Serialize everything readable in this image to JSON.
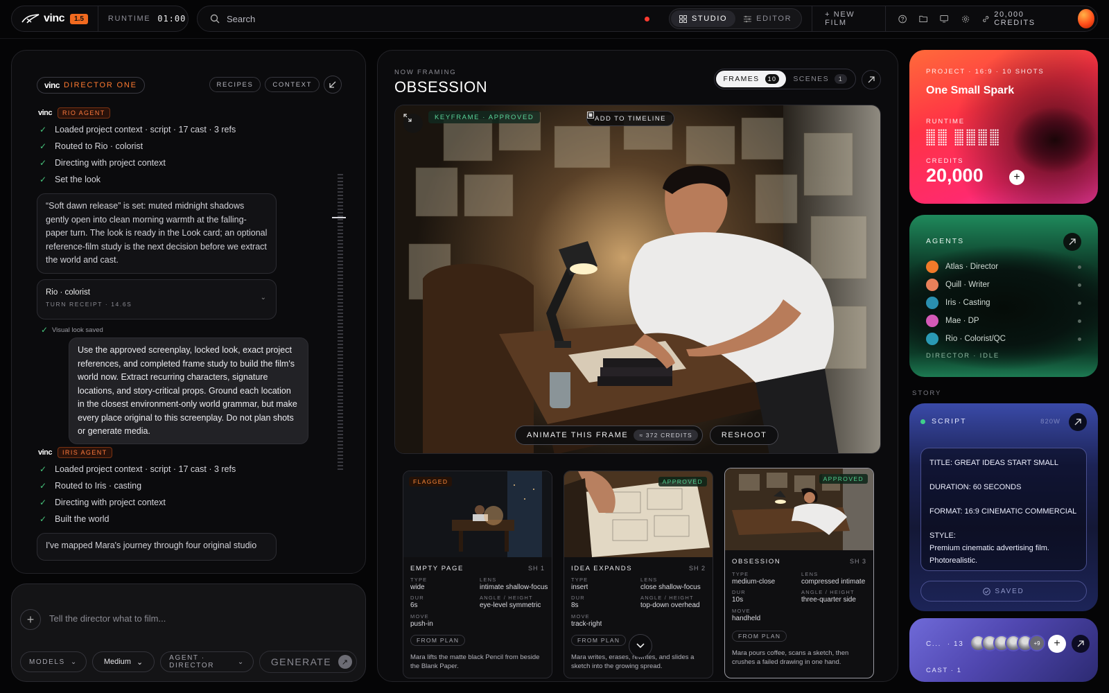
{
  "brand": {
    "name": "vinc",
    "version": "1.5",
    "runtime_label": "RUNTIME",
    "runtime_value": "01:00"
  },
  "search": {
    "placeholder": "Search"
  },
  "modes": [
    {
      "label": "STUDIO",
      "active": true
    },
    {
      "label": "EDITOR",
      "active": false
    }
  ],
  "topbar": {
    "new_film": "+ NEW FILM",
    "credits": "20,000 CREDITS"
  },
  "left": {
    "director_label": "DIRECTOR ONE",
    "buttons": {
      "recipes": "RECIPES",
      "context": "CONTEXT"
    },
    "agent1": {
      "tag": "RIO AGENT",
      "steps": [
        "Loaded project context · script · 17 cast · 3 refs",
        "Routed to Rio · colorist",
        "Directing with project context",
        "Set the look"
      ]
    },
    "message1": "“Soft dawn release” is set: muted midnight shadows gently open into clean morning warmth at the falling-paper turn. The look is ready in the Look card; an optional reference-film study is the next decision before we extract the world and cast.",
    "receipt": {
      "title": "Rio · colorist",
      "sub": "TURN RECEIPT · 14.6S"
    },
    "saved": "Visual look saved",
    "user_msg": "Use the approved screenplay, locked look, exact project references, and completed frame study to build the film's world now. Extract recurring characters, signature locations, and story-critical props. Ground each location in the closest environment-only world grammar, but make every place original to this screenplay. Do not plan shots or generate media.",
    "agent2": {
      "tag": "IRIS AGENT",
      "steps": [
        "Loaded project context · script · 17 cast · 3 refs",
        "Routed to Iris · casting",
        "Directing with project context",
        "Built the world"
      ]
    },
    "message2": "I've mapped Mara's journey through four original studio"
  },
  "composer": {
    "placeholder": "Tell the director what to film...",
    "models": "MODELS",
    "quality": "Medium",
    "agent": "AGENT · DIRECTOR",
    "generate": "GENERATE"
  },
  "center": {
    "now_label": "NOW FRAMING",
    "title": "OBSESSION",
    "frames_label": "FRAMES",
    "frames_count": "10",
    "scenes_label": "SCENES",
    "scenes_count": "1",
    "keyframe_tag": "KEYFRAME · APPROVED",
    "add_timeline": "ADD TO TIMELINE",
    "animate": "ANIMATE THIS FRAME",
    "animate_cost": "≈ 372 CREDITS",
    "reshoot": "RESHOOT"
  },
  "shots": [
    {
      "status": "FLAGGED",
      "name": "EMPTY PAGE",
      "num": "SH 1",
      "type": "wide",
      "lens": "intimate shallow-focus",
      "dur": "6s",
      "angle": "eye-level symmetric",
      "move": "push-in",
      "plan": "FROM PLAN",
      "desc": "Mara lifts the matte black Pencil from beside the Blank Paper."
    },
    {
      "status": "APPROVED",
      "name": "IDEA EXPANDS",
      "num": "SH 2",
      "type": "insert",
      "lens": "close shallow-focus",
      "dur": "8s",
      "angle": "top-down overhead",
      "move": "track-right",
      "plan": "FROM PLAN",
      "desc": "Mara writes, erases, rewrites, and slides a sketch into the growing spread."
    },
    {
      "status": "APPROVED",
      "name": "OBSESSION",
      "num": "SH 3",
      "type": "medium-close",
      "lens": "compressed intimate",
      "dur": "10s",
      "angle": "three-quarter side",
      "move": "handheld",
      "plan": "FROM PLAN",
      "desc": "Mara pours coffee, scans a sketch, then crushes a failed drawing in one hand."
    }
  ],
  "shot_labels": {
    "type": "TYPE",
    "lens": "LENS",
    "dur": "DUR",
    "angle": "ANGLE / HEIGHT",
    "move": "MOVE"
  },
  "project": {
    "meta": "PROJECT · 16:9 · 10 SHOTS",
    "title": "One Small Spark",
    "runtime_label": "RUNTIME",
    "credits_label": "CREDITS",
    "credits": "20,000"
  },
  "agents": {
    "title": "AGENTS",
    "list": [
      {
        "name": "Atlas · Director",
        "color": "#f07a2a"
      },
      {
        "name": "Quill · Writer",
        "color": "#e8805a"
      },
      {
        "name": "Iris · Casting",
        "color": "#2a8fb0"
      },
      {
        "name": "Mae · DP",
        "color": "#d45ab8"
      },
      {
        "name": "Rio · Colorist/QC",
        "color": "#2a9ab4"
      }
    ],
    "status": "DIRECTOR · IDLE"
  },
  "story_label": "STORY",
  "script": {
    "title": "SCRIPT",
    "words": "820W",
    "lines": [
      "TITLE: GREAT IDEAS START SMALL",
      "DURATION: 60 SECONDS",
      "FORMAT: 16:9 CINEMATIC COMMERCIAL",
      "STYLE:",
      "Premium cinematic advertising film.",
      "Photorealistic."
    ],
    "saved": "SAVED"
  },
  "cast": {
    "title": "C...",
    "count": "· 13",
    "more": "+9",
    "sub": "CAST · 1"
  }
}
